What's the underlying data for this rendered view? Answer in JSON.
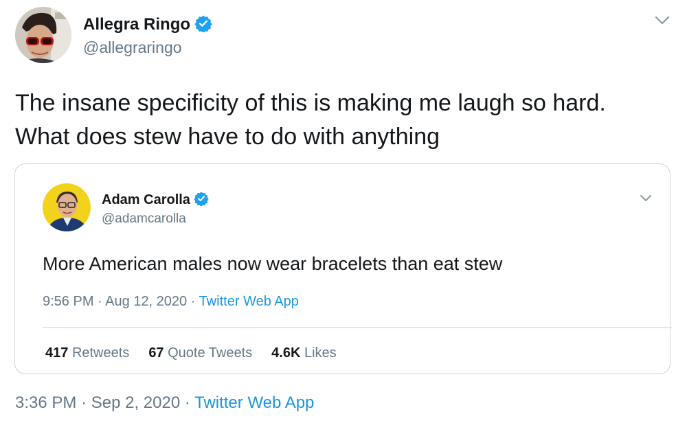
{
  "outer_tweet": {
    "author_name": "Allegra Ringo",
    "author_handle": "@allegraringo",
    "text_line1": "The insane specificity of this is making me laugh so hard.",
    "text_line2": "What does stew have to do with anything",
    "time": "3:36 PM",
    "date": "Sep 2, 2020",
    "source": "Twitter Web App",
    "separator": "·"
  },
  "quoted_tweet": {
    "author_name": "Adam Carolla",
    "author_handle": "@adamcarolla",
    "text": "More American males now wear bracelets  than eat stew",
    "time": "9:56 PM",
    "date": "Aug 12, 2020",
    "source": "Twitter Web App",
    "separator": "·",
    "stats": [
      {
        "count": "417",
        "label": "Retweets"
      },
      {
        "count": "67",
        "label": "Quote Tweets"
      },
      {
        "count": "4.6K",
        "label": "Likes"
      }
    ]
  },
  "colors": {
    "verified_blue": "#1da1f2",
    "link_blue": "#1b95e0",
    "secondary_text": "#657786",
    "border": "#ccd6dd"
  },
  "icons": {
    "verified": "verified-badge-icon",
    "menu": "chevron-down-icon"
  }
}
